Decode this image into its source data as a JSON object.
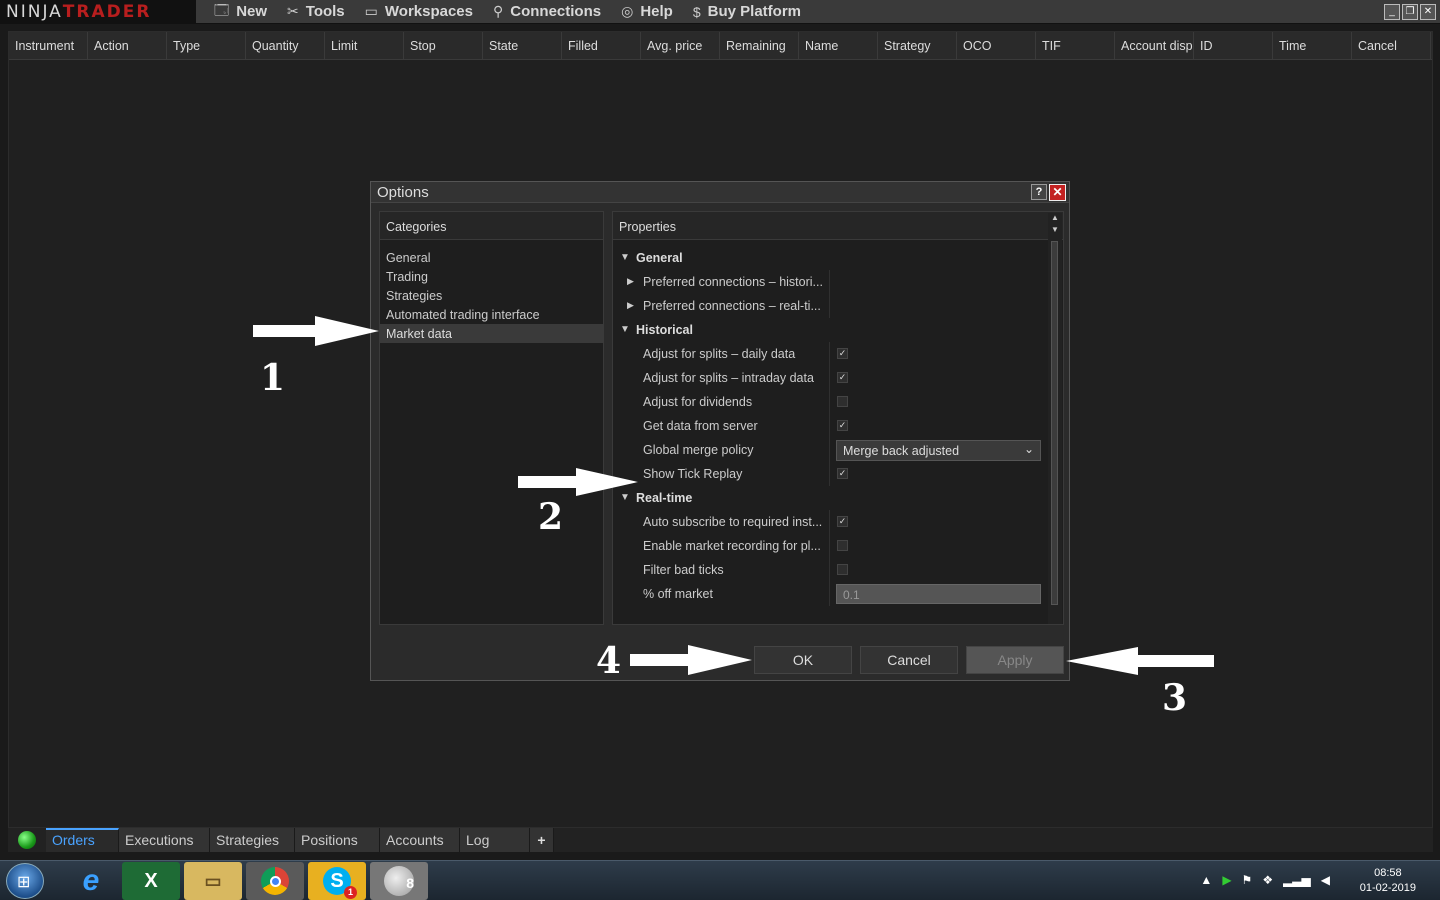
{
  "app": {
    "brand_left": "NINJA",
    "brand_right": "TRADER"
  },
  "menu": [
    {
      "label": "New",
      "icon": "new-window-icon"
    },
    {
      "label": "Tools",
      "icon": "tools-icon"
    },
    {
      "label": "Workspaces",
      "icon": "workspaces-icon"
    },
    {
      "label": "Connections",
      "icon": "connections-plug-icon"
    },
    {
      "label": "Help",
      "icon": "help-lifebuoy-icon"
    },
    {
      "label": "Buy Platform",
      "icon": "dollar-icon"
    }
  ],
  "grid": {
    "columns": [
      "Instrument",
      "Action",
      "Type",
      "Quantity",
      "Limit",
      "Stop",
      "State",
      "Filled",
      "Avg. price",
      "Remaining",
      "Name",
      "Strategy",
      "OCO",
      "TIF",
      "Account disp",
      "ID",
      "Time",
      "Cancel"
    ]
  },
  "bottom_tabs": [
    {
      "label": "Orders",
      "active": true
    },
    {
      "label": "Executions",
      "active": false
    },
    {
      "label": "Strategies",
      "active": false
    },
    {
      "label": "Positions",
      "active": false
    },
    {
      "label": "Accounts",
      "active": false
    },
    {
      "label": "Log",
      "active": false
    },
    {
      "label": "+",
      "active": false
    }
  ],
  "dialog": {
    "title": "Options",
    "help_label": "?",
    "close_label": "✕",
    "categories_header": "Categories",
    "categories": [
      "General",
      "Trading",
      "Strategies",
      "Automated trading interface",
      "Market data"
    ],
    "selected_category": "Market data",
    "properties_header": "Properties",
    "properties": [
      {
        "kind": "group",
        "label": "General"
      },
      {
        "kind": "sub",
        "label": "Preferred connections – histori..."
      },
      {
        "kind": "sub",
        "label": "Preferred connections – real-ti..."
      },
      {
        "kind": "group",
        "label": "Historical"
      },
      {
        "kind": "check",
        "label": "Adjust for splits – daily data",
        "checked": true
      },
      {
        "kind": "check",
        "label": "Adjust for splits – intraday data",
        "checked": true
      },
      {
        "kind": "check",
        "label": "Adjust for dividends",
        "checked": false
      },
      {
        "kind": "check",
        "label": "Get data from server",
        "checked": true
      },
      {
        "kind": "select",
        "label": "Global merge policy",
        "value": "Merge back adjusted"
      },
      {
        "kind": "check",
        "label": "Show Tick Replay",
        "checked": true
      },
      {
        "kind": "group",
        "label": "Real-time"
      },
      {
        "kind": "check",
        "label": "Auto subscribe to required inst...",
        "checked": true
      },
      {
        "kind": "check",
        "label": "Enable market recording for pl...",
        "checked": false
      },
      {
        "kind": "check",
        "label": "Filter bad ticks",
        "checked": false
      },
      {
        "kind": "number",
        "label": "% off market",
        "value": "0.1"
      }
    ],
    "buttons": {
      "ok": "OK",
      "cancel": "Cancel",
      "apply": "Apply"
    }
  },
  "annotations": {
    "one": "1",
    "two": "2",
    "three": "3",
    "four": "4"
  },
  "taskbar": {
    "skype_badge": "1",
    "ninja_badge": "8",
    "time": "08:58",
    "date": "01-02-2019"
  },
  "colors": {
    "accent": "#4aa3ff",
    "brand_red": "#b81e1e",
    "close_red": "#c32222"
  }
}
